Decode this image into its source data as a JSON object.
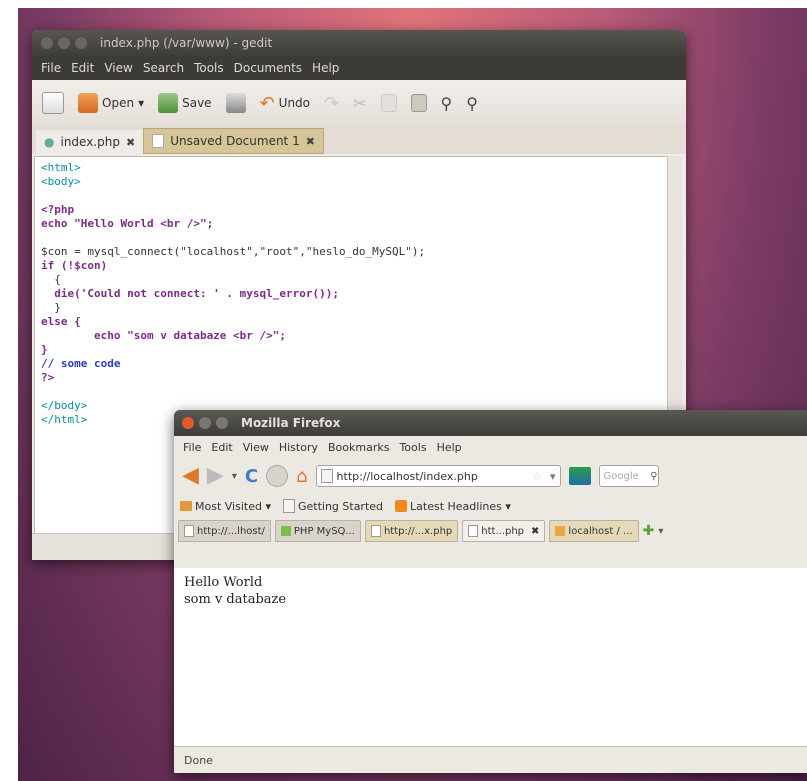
{
  "gedit": {
    "title": "index.php (/var/www) - gedit",
    "menu": [
      "File",
      "Edit",
      "View",
      "Search",
      "Tools",
      "Documents",
      "Help"
    ],
    "toolbar": {
      "open": "Open",
      "save": "Save",
      "undo": "Undo"
    },
    "tabs": [
      {
        "label": "index.php",
        "close": "✖"
      },
      {
        "label": "Unsaved Document 1",
        "close": "✖"
      }
    ],
    "code": [
      "<html>",
      "<body>",
      "",
      "<?php",
      "echo \"Hello World <br />\";",
      "",
      "$con = mysql_connect(\"localhost\",\"root\",\"heslo_do_MySQL\");",
      "if (!$con)",
      "  {",
      "  die('Could not connect: ' . mysql_error());",
      "  }",
      "else {",
      "        echo \"som v databaze <br />\";",
      "}",
      "// some code",
      "?>",
      "",
      "</body>",
      "</html>"
    ]
  },
  "firefox": {
    "title": "Mozilla Firefox",
    "menu": [
      "File",
      "Edit",
      "View",
      "History",
      "Bookmarks",
      "Tools",
      "Help"
    ],
    "url": "http://localhost/index.php",
    "search_placeholder": "Google",
    "bookmarks": [
      "Most Visited ▾",
      "Getting Started",
      "Latest Headlines ▾"
    ],
    "tabs": [
      "http://...lhost/",
      "PHP MySQ...",
      "http://...x.php",
      "htt...php",
      "localhost / ..."
    ],
    "content_lines": [
      "Hello World",
      "som v databaze"
    ],
    "status": "Done"
  }
}
